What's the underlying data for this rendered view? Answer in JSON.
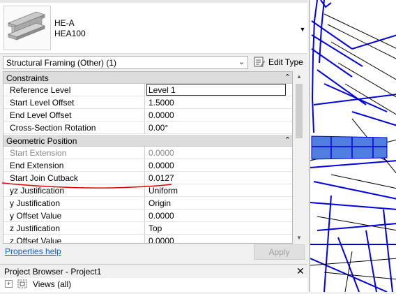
{
  "type_selector": {
    "family": "HE-A",
    "type": "HEA100"
  },
  "filter": {
    "value": "Structural Framing (Other) (1)",
    "edit_type_label": "Edit Type"
  },
  "sections": [
    {
      "label": "Constraints",
      "rows": [
        {
          "name": "Reference Level",
          "value": "Level 1"
        },
        {
          "name": "Start Level Offset",
          "value": "1.5000"
        },
        {
          "name": "End Level Offset",
          "value": "0.0000"
        },
        {
          "name": "Cross-Section Rotation",
          "value": "0.00°"
        }
      ]
    },
    {
      "label": "Geometric Position",
      "rows": [
        {
          "name": "Start Extension",
          "value": "0.0000"
        },
        {
          "name": "End Extension",
          "value": "0.0000"
        },
        {
          "name": "Start Join Cutback",
          "value": "0.0127"
        },
        {
          "name": "yz Justification",
          "value": "Uniform"
        },
        {
          "name": "y Justification",
          "value": "Origin"
        },
        {
          "name": "y Offset Value",
          "value": "0.0000"
        },
        {
          "name": "z Justification",
          "value": "Top"
        },
        {
          "name": "z Offset Value",
          "value": "0.0000"
        }
      ]
    }
  ],
  "footer": {
    "help_link": "Properties help",
    "apply_label": "Apply"
  },
  "project_browser": {
    "title": "Project Browser - Project1",
    "root_item": "Views (all)"
  },
  "icons": {
    "edit_type": "edit-type-icon",
    "collapse": "collapse-chevron-icon",
    "close": "close-icon",
    "views": "views-icon"
  },
  "colors": {
    "accent_link": "#1a5fb4",
    "annotation": "#e00000",
    "model_lines": "#0000e0",
    "beam_fill": "#4f7de0"
  }
}
